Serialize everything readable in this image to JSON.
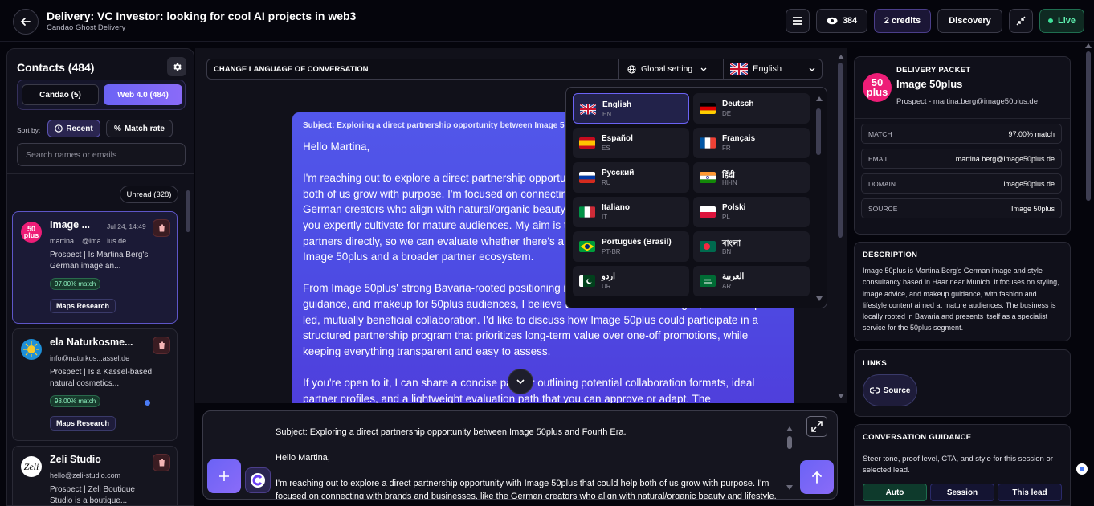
{
  "header": {
    "title": "Delivery: VC Investor: looking for cool AI projects in web3",
    "subtitle": "Candao Ghost Delivery",
    "views": "384",
    "credits": "2 credits",
    "discovery": "Discovery",
    "live": "Live"
  },
  "contacts": {
    "title": "Contacts (484)",
    "tab_candao": "Candao (5)",
    "tab_web4": "Web 4.0 (484)",
    "sort_by": "Sort by:",
    "sort_recent": "Recent",
    "sort_match": "Match rate",
    "search_placeholder": "Search names or emails",
    "unread": "Unread (328)",
    "items": [
      {
        "avatar": "50 plus",
        "name": "Image ...",
        "date": "Jul 24, 14:49",
        "email": "martina....@ima...lus.de",
        "desc": "Prospect | Is Martina Berg's German image an...",
        "match": "97.00% match",
        "tag": "Maps Research"
      },
      {
        "name": "ela Naturkosme...",
        "email": "info@naturkos...assel.de",
        "desc": "Prospect | Is a Kassel-based natural cosmetics...",
        "match": "98.00% match",
        "tag": "Maps Research"
      },
      {
        "avatar": "Zeli",
        "name": "Zeli Studio",
        "email": "hello@zeli-studio.com",
        "desc": "Prospect | Zeli Boutique Studio is a boutique..."
      }
    ]
  },
  "language": {
    "bar_label": "CHANGE LANGUAGE OF CONVERSATION",
    "global": "Global setting",
    "selected": "English",
    "options": [
      {
        "name": "English",
        "code": "EN"
      },
      {
        "name": "Deutsch",
        "code": "DE"
      },
      {
        "name": "Español",
        "code": "ES"
      },
      {
        "name": "Français",
        "code": "FR"
      },
      {
        "name": "Русский",
        "code": "RU"
      },
      {
        "name": "हिंदी",
        "code": "HI-IN"
      },
      {
        "name": "Italiano",
        "code": "IT"
      },
      {
        "name": "Polski",
        "code": "PL"
      },
      {
        "name": "Português (Brasil)",
        "code": "PT-BR"
      },
      {
        "name": "বাংলা",
        "code": "BN"
      },
      {
        "name": "اردو",
        "code": "UR"
      },
      {
        "name": "العربية",
        "code": "AR"
      }
    ]
  },
  "message": {
    "subject": "Subject: Exploring a direct partnership opportunity between Image 50plus and Fourth Era.",
    "greeting": "Hello Martina,",
    "p1": "I'm reaching out to explore a direct partnership opportunity with Image 50plus that could help both of us grow with purpose. I'm focused on connecting with brands and businesses, like the German creators who align with natural/organic beauty and lifestyle, and bring the kind of trust you expertly cultivate for mature audiences. My aim is to build a partnership that connects with partners directly, so we can evaluate whether there's a fit for a model that genuinely benefits Image 50plus and a broader partner ecosystem.",
    "p2": "From Image 50plus' strong Bavaria-rooted positioning in personal styling, image consulting, guidance, and makeup for 50plus audiences, I believe there could be a meaningful, relationship-led, mutually beneficial collaboration. I'd like to discuss how Image 50plus could participate in a structured partnership program that prioritizes long-term value over one-off promotions, while keeping everything transparent and easy to assess.",
    "p3": "If you're open to it, I can share a concise partner outlining potential collaboration formats, ideal partner profiles, and a lightweight evaluation path that you can approve or adapt. The"
  },
  "composer": {
    "subject": "Subject: Exploring a direct partnership opportunity between Image 50plus and Fourth Era.",
    "greeting": "Hello Martina,",
    "p1": "I'm reaching out to explore a direct partnership opportunity with Image 50plus that could help both of us grow with purpose. I'm focused on connecting with brands and businesses, like the German creators who align with natural/organic beauty and lifestyle."
  },
  "packet": {
    "eyebrow": "DELIVERY PACKET",
    "avatar": "50 plus",
    "name": "Image 50plus",
    "sub": "Prospect - martina.berg@image50plus.de",
    "match_k": "MATCH",
    "match_v": "97.00% match",
    "email_k": "EMAIL",
    "email_v": "martina.berg@image50plus.de",
    "domain_k": "DOMAIN",
    "domain_v": "image50plus.de",
    "source_k": "SOURCE",
    "source_v": "Image 50plus"
  },
  "description": {
    "title": "DESCRIPTION",
    "text": "Image 50plus is Martina Berg's German image and style consultancy based in Haar near Munich. It focuses on styling, image advice, and makeup guidance, with fashion and lifestyle content aimed at mature audiences. The business is locally rooted in Bavaria and presents itself as a specialist service for the 50plus segment."
  },
  "links": {
    "title": "LINKS",
    "source": "Source"
  },
  "guidance": {
    "title": "CONVERSATION GUIDANCE",
    "text": "Steer tone, proof level, CTA, and style for this session or selected lead.",
    "auto": "Auto",
    "session": "Session",
    "lead": "This lead"
  },
  "colors": {
    "accent": "#6b63f5",
    "live": "#3fe29a",
    "brand_pink": "#ee1d77"
  }
}
